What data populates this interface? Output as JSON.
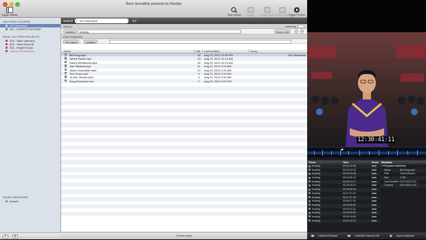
{
  "window": {
    "title": "Boris Soundbite powered by Nexidia"
  },
  "toolbar": {
    "toggle_sidebar": "Toggle Sidebar",
    "buttons": [
      "New Search",
      "Trigger Metadata",
      "Create Smart Clip",
      "Create Smart Clip",
      "Toggle Preview"
    ]
  },
  "sidebar": {
    "watched_header": "WATCHED FOLDERS",
    "watched": [
      {
        "label": "021 Interviews",
        "selected": true,
        "color": "#6b87b6"
      },
      {
        "label": "031 - KNIGHT FOOTAGE",
        "selected": false,
        "color": "#6b87b6"
      }
    ],
    "fcp_header": "FINAL CUT PRO PROJECTS",
    "fcp": [
      {
        "label": "029 - Steel Interview",
        "color": "#c24a4a"
      },
      {
        "label": "029 - Steel Kirby 06",
        "color": "#c24a4a"
      },
      {
        "label": "031 - Knight Knock",
        "color": "#c24a4a"
      },
      {
        "label": "Cherry Pie Interview",
        "color": "#c24a4a",
        "red": true
      }
    ],
    "saved_header": "SAVED SEARCHES",
    "saved": [
      "Arcade"
    ]
  },
  "search": {
    "label": "Search",
    "in_value": "021 Interviews",
    "for_label": "for:",
    "sub_label": "Search",
    "sub_right": "matching",
    "contains": "contains",
    "query": "bowling",
    "score": "Score ≥ 65",
    "other_attributes": "Other Attributes",
    "file_name": "File Name",
    "contains2": "contains"
  },
  "table": {
    "headers": [
      "Name",
      "Hits",
      "Last Modified",
      "Group"
    ],
    "rows": [
      {
        "name": "Bill Fong.mp4",
        "hits": "16",
        "modified": "Aug 22, 2012 11:38 PM",
        "group": "021 Interviews",
        "selected": true
      },
      {
        "name": "James Racie.mp4",
        "hits": "19",
        "modified": "Aug 22, 2012 12:14 AM",
        "group": ""
      },
      {
        "name": "Danny Westbrook.mp4",
        "hits": "18",
        "modified": "Aug 22, 2012 12:22 AM",
        "group": ""
      },
      {
        "name": "Joel Siddlow.mp4",
        "hits": "11",
        "modified": "Aug 22, 2012 2:23 AM",
        "group": ""
      },
      {
        "name": "Jason Overstreet.mp4",
        "hits": "10",
        "modified": "Aug 22, 2012 1:31 AM",
        "group": ""
      },
      {
        "name": "Tom Dunn.mp4",
        "hits": "4",
        "modified": "Aug 22, 2012 2:43 AM",
        "group": ""
      },
      {
        "name": "Jo Ann Gibson.mp4",
        "hits": "4",
        "modified": "Aug 22, 2012 1:52 AM",
        "group": ""
      },
      {
        "name": "Doug Swenson.mov",
        "hits": "2",
        "modified": "Aug 29, 2012 3:02 PM",
        "group": ""
      }
    ]
  },
  "status": {
    "text": "8 items found"
  },
  "player": {
    "timecode": "12:30:41:11",
    "results": {
      "header_terms": "Terms",
      "header_time": "Time",
      "header_score": "Score",
      "rows": [
        {
          "term": "bowling",
          "time": "00:23:10.88"
        },
        {
          "term": "bowling",
          "time": "00:23:13.34"
        },
        {
          "term": "bowling",
          "time": "00:23:53.38"
        },
        {
          "term": "bowling",
          "time": "00:24:46.12"
        },
        {
          "term": "bowling",
          "time": "00:25:14.17"
        },
        {
          "term": "bowling",
          "time": "00:25:26.01"
        },
        {
          "term": "bowling",
          "time": "00:26:55.28"
        },
        {
          "term": "bowling",
          "time": "00:27:27.42"
        },
        {
          "term": "bowling",
          "time": "00:27:57.06"
        },
        {
          "term": "bowling",
          "time": "00:28:17.00"
        },
        {
          "term": "bowling",
          "time": "00:28:56.60"
        },
        {
          "term": "bowling",
          "time": "00:29:14.11"
        },
        {
          "term": "bowling",
          "time": "00:29:55.89"
        },
        {
          "term": "bowling",
          "time": "00:30:18.89"
        },
        {
          "term": "bowling",
          "time": "00:30:43.23"
        }
      ]
    },
    "meta": {
      "header": "Metadata",
      "group": "Filesystem Attributes",
      "rows": [
        {
          "key": "Name",
          "value": "Bill Fong.mp4"
        },
        {
          "key": "Path",
          "value": "/Users/admin/..."
        },
        {
          "key": "Size",
          "value": "2 GB"
        },
        {
          "key": "Last Modified",
          "value": "2012-08-22 03:..."
        },
        {
          "key": "Created",
          "value": "2012-08-22 03:..."
        }
      ]
    },
    "bottom": {
      "prev_next_result": "Last/Next Result",
      "prev_next_speech": "Last/Next Speech Hit",
      "export": "Export Markers"
    }
  }
}
